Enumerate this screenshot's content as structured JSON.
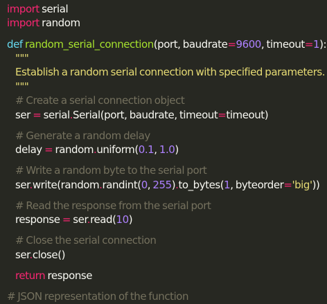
{
  "editor": {
    "background": "#272822",
    "colors": {
      "keyword": "#f92672",
      "storage": "#66d9ef",
      "function": "#a6e22e",
      "number": "#ae81ff",
      "string": "#e6db74",
      "comment": "#75715e",
      "text": "#f8f8f2"
    },
    "lines": {
      "l1": [
        "import",
        " serial"
      ],
      "l2": [
        "import",
        " random"
      ],
      "l3": [
        "def",
        " ",
        "random_serial_connection",
        "(port, baudrate",
        "=",
        "9600",
        ", timeout",
        "=",
        "1",
        "):"
      ],
      "l4": [
        "\"\"\""
      ],
      "l5": [
        "Establish a random serial connection with specified parameters."
      ],
      "l6": [
        "\"\"\""
      ],
      "l7": [
        "# Create a serial connection object"
      ],
      "l8": [
        "ser ",
        "=",
        " serial",
        ".",
        "Serial(port, baudrate, timeout",
        "=",
        "timeout)"
      ],
      "l9": [
        "# Generate a random delay"
      ],
      "l10": [
        "delay ",
        "=",
        " random",
        ".",
        "uniform(",
        "0.1",
        ", ",
        "1.0",
        ")"
      ],
      "l11": [
        "# Write a random byte to the serial port"
      ],
      "l12": [
        "ser",
        ".",
        "write(random",
        ".",
        "randint(",
        "0",
        ", ",
        "255",
        ")",
        ".",
        "to_bytes(",
        "1",
        ", byteorder",
        "=",
        "'big'",
        "))"
      ],
      "l13": [
        "# Read the response from the serial port"
      ],
      "l14": [
        "response ",
        "=",
        " ser",
        ".",
        "read(",
        "10",
        ")"
      ],
      "l15": [
        "# Close the serial connection"
      ],
      "l16": [
        "ser",
        ".",
        "close()"
      ],
      "l17": [
        "return",
        " response"
      ],
      "l18": [
        "# JSON representation of the function"
      ]
    }
  }
}
